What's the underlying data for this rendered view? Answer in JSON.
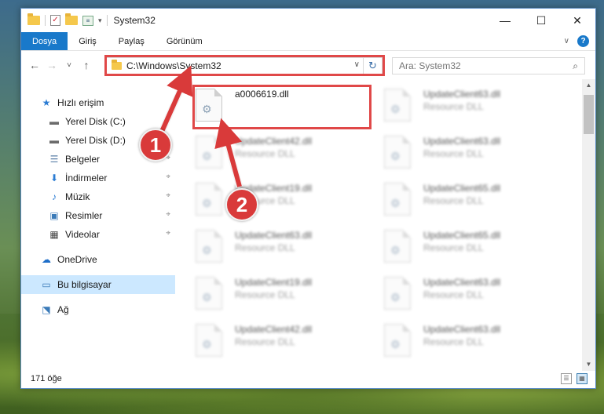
{
  "window": {
    "title": "System32",
    "controls": {
      "minimize": "—",
      "maximize": "☐",
      "close": "✕"
    }
  },
  "ribbon": {
    "tabs": [
      "Dosya",
      "Giriş",
      "Paylaş",
      "Görünüm"
    ],
    "help": "?",
    "collapse": "∨"
  },
  "nav": {
    "back": "←",
    "forward": "→",
    "recent": "˅",
    "up": "↑",
    "address": "C:\\Windows\\System32",
    "address_dropdown": "∨",
    "refresh": "↻",
    "search_placeholder": "Ara: System32",
    "search_icon": "⌕"
  },
  "sidebar": {
    "items": [
      {
        "label": "Hızlı erişim",
        "icon": "star-icon",
        "glyph": "★",
        "color": "#2b7cd3",
        "pinned": false
      },
      {
        "label": "Yerel Disk (C:)",
        "icon": "drive-icon",
        "glyph": "▬",
        "color": "#6b6b6b",
        "pinned": true
      },
      {
        "label": "Yerel Disk (D:)",
        "icon": "drive-icon",
        "glyph": "▬",
        "color": "#6b6b6b",
        "pinned": true
      },
      {
        "label": "Belgeler",
        "icon": "document-icon",
        "glyph": "☰",
        "color": "#5a7fa8",
        "pinned": true
      },
      {
        "label": "İndirmeler",
        "icon": "download-icon",
        "glyph": "⬇",
        "color": "#2b7cd3",
        "pinned": true
      },
      {
        "label": "Müzik",
        "icon": "music-icon",
        "glyph": "♪",
        "color": "#2b7cd3",
        "pinned": true
      },
      {
        "label": "Resimler",
        "icon": "picture-icon",
        "glyph": "▣",
        "color": "#3a7ab8",
        "pinned": true
      },
      {
        "label": "Videolar",
        "icon": "video-icon",
        "glyph": "▦",
        "color": "#444444",
        "pinned": true
      },
      {
        "label": "OneDrive",
        "icon": "cloud-icon",
        "glyph": "☁",
        "color": "#1e6ec8",
        "pinned": false
      },
      {
        "label": "Bu bilgisayar",
        "icon": "computer-icon",
        "glyph": "▭",
        "color": "#3a7ab8",
        "pinned": false,
        "selected": true
      },
      {
        "label": "Ağ",
        "icon": "network-icon",
        "glyph": "⬔",
        "color": "#3a7ab8",
        "pinned": false
      }
    ],
    "pin_glyph": "⌖"
  },
  "files": [
    {
      "name": "a0006619.dll",
      "type": "",
      "blurred": false
    },
    {
      "name": "UpdateClient63.dll",
      "type": "Resource DLL",
      "blurred": true
    },
    {
      "name": "UpdateClient42.dll",
      "type": "Resource DLL",
      "blurred": true
    },
    {
      "name": "UpdateClient63.dll",
      "type": "Resource DLL",
      "blurred": true
    },
    {
      "name": "UpdateClient19.dll",
      "type": "Resource DLL",
      "blurred": true
    },
    {
      "name": "UpdateClient65.dll",
      "type": "Resource DLL",
      "blurred": true
    },
    {
      "name": "UpdateClient63.dll",
      "type": "Resource DLL",
      "blurred": true
    },
    {
      "name": "UpdateClient65.dll",
      "type": "Resource DLL",
      "blurred": true
    },
    {
      "name": "UpdateClient19.dll",
      "type": "Resource DLL",
      "blurred": true
    },
    {
      "name": "UpdateClient63.dll",
      "type": "Resource DLL",
      "blurred": true
    },
    {
      "name": "UpdateClient42.dll",
      "type": "Resource DLL",
      "blurred": true
    },
    {
      "name": "UpdateClient63.dll",
      "type": "Resource DLL",
      "blurred": true
    }
  ],
  "status": {
    "count": "171 öğe"
  },
  "annotations": {
    "step1": "1",
    "step2": "2",
    "color": "#d93a3a"
  }
}
